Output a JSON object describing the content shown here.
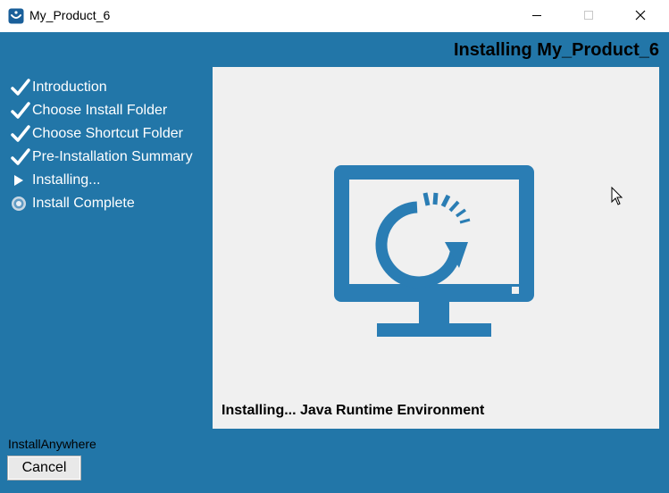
{
  "window": {
    "title": "My_Product_6",
    "app_icon": "installanywhere-icon",
    "controls": [
      "minimize-icon",
      "maximize-icon",
      "close-icon"
    ]
  },
  "header": {
    "title": "Installing My_Product_6"
  },
  "steps": [
    {
      "label": "Introduction",
      "state": "done",
      "icon": "checkmark-icon"
    },
    {
      "label": "Choose Install Folder",
      "state": "done",
      "icon": "checkmark-icon"
    },
    {
      "label": "Choose Shortcut Folder",
      "state": "done",
      "icon": "checkmark-icon"
    },
    {
      "label": "Pre-Installation Summary",
      "state": "done",
      "icon": "checkmark-icon"
    },
    {
      "label": "Installing...",
      "state": "current",
      "icon": "play-arrow-icon"
    },
    {
      "label": "Install Complete",
      "state": "pending",
      "icon": "radio-dot-icon"
    }
  ],
  "content": {
    "graphic": "monitor-refresh-icon",
    "status": "Installing... Java Runtime Environment"
  },
  "footer": {
    "vendor": "InstallAnywhere",
    "cancel_label": "Cancel"
  },
  "colors": {
    "background": "#2276a8",
    "panel": "#f0f0f0",
    "graphic": "#2a7db4"
  }
}
